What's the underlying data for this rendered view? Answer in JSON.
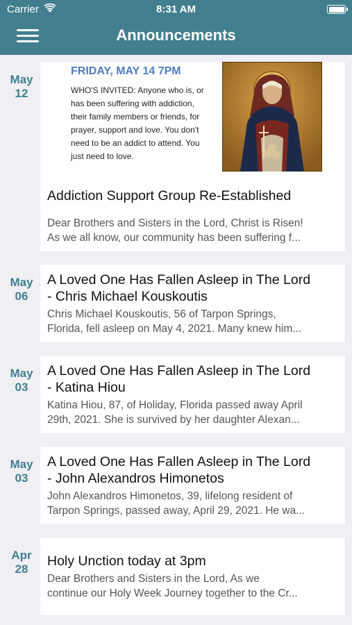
{
  "status": {
    "carrier": "Carrier",
    "time": "8:31 AM"
  },
  "header": {
    "title": "Announcements"
  },
  "announcements": [
    {
      "month": "May",
      "day": "12",
      "image": {
        "heading": "FRIDAY, MAY 14 7PM",
        "body": "WHO'S INVITED: Anyone who is, or has been suffering with addiction, their family members or friends, for prayer, support and love. You don't need to be an addict to attend. You just need to love."
      },
      "title": "Addiction Support Group Re-Established",
      "excerpt_l1": "Dear Brothers and Sisters in the Lord, Christ is Risen!",
      "excerpt_l2": "As we all know, our community has been suffering f..."
    },
    {
      "month": "May",
      "day": "06",
      "title_l1": "A Loved One Has Fallen Asleep in The Lord",
      "title_l2": "- Chris Michael Kouskoutis",
      "excerpt_l1": "Chris Michael Kouskoutis, 56 of Tarpon Springs,",
      "excerpt_l2": "Florida, fell asleep on May 4, 2021. Many knew him..."
    },
    {
      "month": "May",
      "day": "03",
      "title_l1": "A Loved One Has Fallen Asleep in The Lord",
      "title_l2": "- Katina Hiou",
      "excerpt_l1": "Katina Hiou, 87, of Holiday, Florida passed away April",
      "excerpt_l2": "29th, 2021. She is survived by her daughter Alexan..."
    },
    {
      "month": "May",
      "day": "03",
      "title_l1": "A Loved One Has Fallen Asleep in The Lord",
      "title_l2": "- John Alexandros Himonetos",
      "excerpt_l1": "John Alexandros Himonetos, 39, lifelong resident of",
      "excerpt_l2": "Tarpon Springs, passed away, April 29, 2021. He wa..."
    },
    {
      "month": "Apr",
      "day": "28",
      "title": "Holy Unction today at 3pm",
      "excerpt_l1": "Dear Brothers and Sisters in the Lord, As we",
      "excerpt_l2": "continue our Holy Week Journey together to the Cr..."
    }
  ],
  "colors": {
    "accent": "#427f8e",
    "background": "#f0eff4",
    "flyer_heading": "#4f7cc0"
  },
  "icons": [
    "wifi-icon",
    "battery-icon",
    "hamburger-menu-icon"
  ]
}
